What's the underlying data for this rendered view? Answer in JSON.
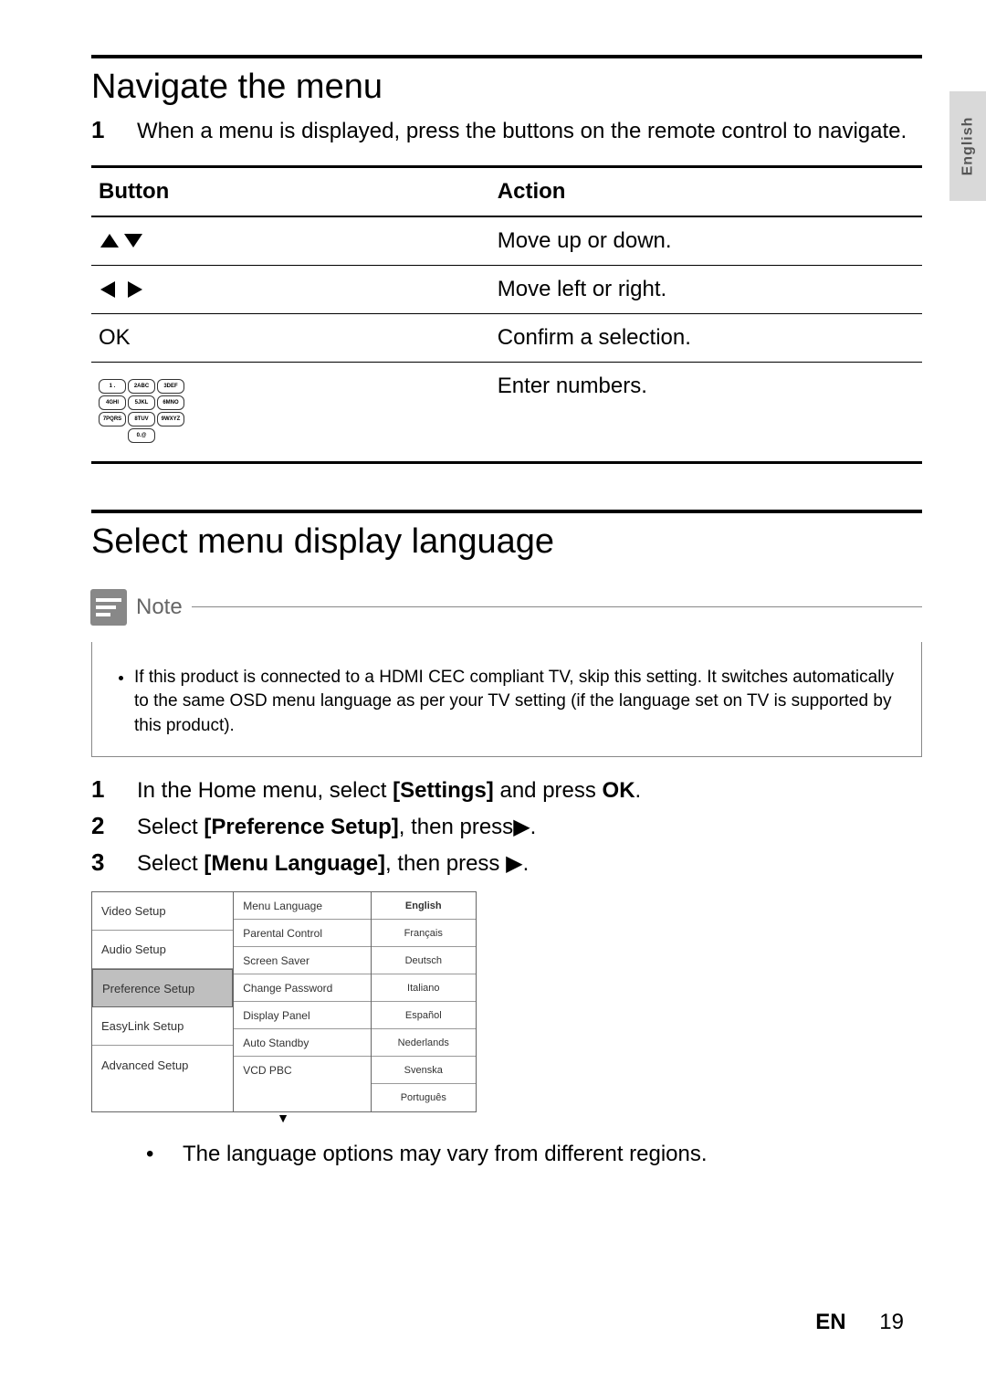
{
  "sideTab": "English",
  "section1": {
    "title": "Navigate the menu",
    "step1_num": "1",
    "step1_text": "When a menu is displayed, press the buttons on the remote control to navigate."
  },
  "table": {
    "headers": {
      "button": "Button",
      "action": "Action"
    },
    "rows": [
      {
        "buttonLabel": "up-down-arrows",
        "action": "Move up or down."
      },
      {
        "buttonLabel": "left-right-arrows",
        "action": "Move left or right."
      },
      {
        "buttonLabel": "OK",
        "action": "Confirm a selection."
      },
      {
        "buttonLabel": "keypad",
        "action": "Enter numbers."
      }
    ],
    "keypad": [
      [
        "1 .",
        "2ABC",
        "3DEF"
      ],
      [
        "4GHI",
        "5JKL",
        "6MNO"
      ],
      [
        "7PQRS",
        "8TUV",
        "9WXYZ"
      ],
      [
        "0.@"
      ]
    ]
  },
  "section2": {
    "title": "Select menu display language"
  },
  "note": {
    "label": "Note",
    "text": "If this product is connected to a HDMI CEC compliant TV, skip this setting. It switches automatically to the same OSD menu language as per your TV setting (if the language set on TV is supported by this product)."
  },
  "steps": [
    {
      "num": "1",
      "pre": "In the Home menu, select ",
      "bold1": "[Settings]",
      "mid": " and press ",
      "bold2": "OK",
      "post": "."
    },
    {
      "num": "2",
      "pre": "Select ",
      "bold1": "[Preference Setup]",
      "mid": ", then press",
      "bold2": "",
      "post": "",
      "arrow": true
    },
    {
      "num": "3",
      "pre": "Select ",
      "bold1": "[Menu Language]",
      "mid": ", then press ",
      "bold2": "",
      "post": "",
      "arrow": true
    }
  ],
  "menuShot": {
    "left": [
      "Video Setup",
      "Audio Setup",
      "Preference Setup",
      "EasyLink Setup",
      "Advanced Setup"
    ],
    "leftSelectedIndex": 2,
    "mid": [
      "Menu Language",
      "Parental Control",
      "Screen Saver",
      "Change Password",
      "Display Panel",
      "Auto Standby",
      "VCD PBC"
    ],
    "right": [
      "English",
      "Français",
      "Deutsch",
      "Italiano",
      "Español",
      "Nederlands",
      "Svenska",
      "Português"
    ],
    "rightSelectedIndex": 0
  },
  "bulletNote": "The language options may vary from different regions.",
  "footer": {
    "lang": "EN",
    "page": "19"
  }
}
